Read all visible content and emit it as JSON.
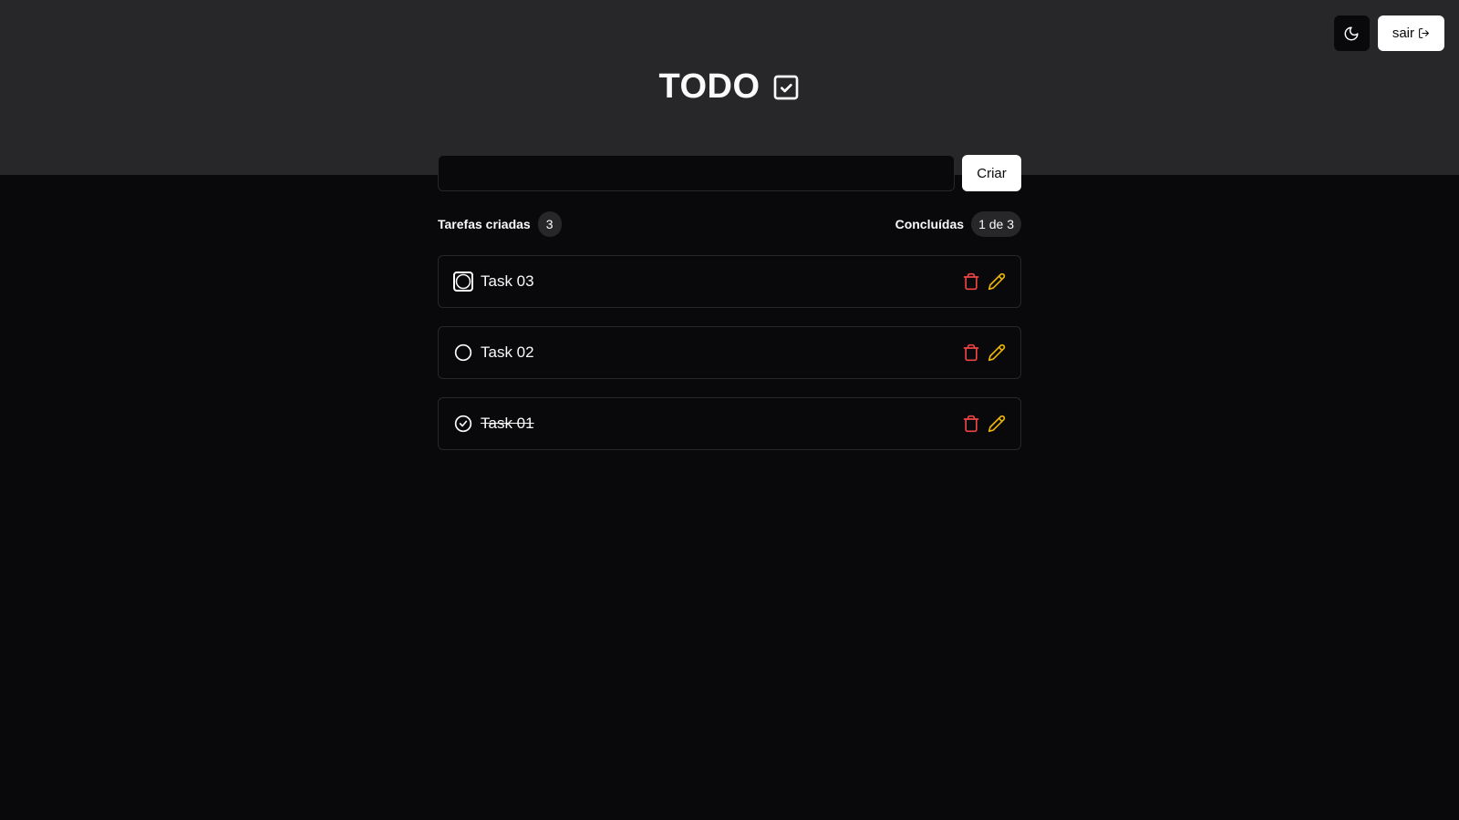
{
  "header": {
    "title": "TODO",
    "title_icon": "check-square-icon",
    "theme_toggle_icon": "moon-icon",
    "logout_label": "sair",
    "logout_icon": "log-out-icon"
  },
  "new_task": {
    "value": "",
    "placeholder": "",
    "create_label": "Criar"
  },
  "counters": {
    "created_label": "Tarefas criadas",
    "created_count": "3",
    "done_label": "Concluídas",
    "done_count": "1 de 3"
  },
  "tasks": [
    {
      "title": "Task 03",
      "done": false,
      "focused": true
    },
    {
      "title": "Task 02",
      "done": false,
      "focused": false
    },
    {
      "title": "Task 01",
      "done": true,
      "focused": false
    }
  ],
  "colors": {
    "header_bg": "#27272a",
    "page_bg": "#09090b",
    "delete": "#ef4444",
    "edit": "#eab308"
  }
}
